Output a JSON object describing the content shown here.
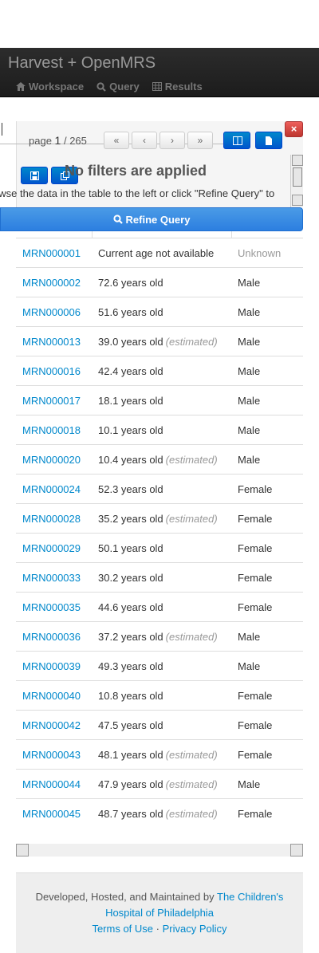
{
  "app": {
    "title": "Harvest + OpenMRS"
  },
  "nav": [
    {
      "label": "Workspace",
      "icon": "home-icon"
    },
    {
      "label": "Query",
      "icon": "search-icon"
    },
    {
      "label": "Results",
      "icon": "table-icon"
    }
  ],
  "pagination": {
    "prefix": "page",
    "current": "1",
    "total": "/ 265",
    "first_label": "«",
    "prev_label": "‹",
    "next_label": "›",
    "last_label": "»"
  },
  "panel": {
    "close_label": "×",
    "title": "No filters are applied",
    "text": "owse the data in the table to the left or click \"Refine Query\" to",
    "refine_label": "Refine Query"
  },
  "rows": [
    {
      "mrn": "MRN000001",
      "age": "Current age not available",
      "estimated": "",
      "sex": "Unknown"
    },
    {
      "mrn": "MRN000002",
      "age": "72.6 years old",
      "estimated": "",
      "sex": "Male"
    },
    {
      "mrn": "MRN000006",
      "age": "51.6 years old",
      "estimated": "",
      "sex": "Male"
    },
    {
      "mrn": "MRN000013",
      "age": "39.0 years old",
      "estimated": "(estimated)",
      "sex": "Male"
    },
    {
      "mrn": "MRN000016",
      "age": "42.4 years old",
      "estimated": "",
      "sex": "Male"
    },
    {
      "mrn": "MRN000017",
      "age": "18.1 years old",
      "estimated": "",
      "sex": "Male"
    },
    {
      "mrn": "MRN000018",
      "age": "10.1 years old",
      "estimated": "",
      "sex": "Male"
    },
    {
      "mrn": "MRN000020",
      "age": "10.4 years old",
      "estimated": "(estimated)",
      "sex": "Male"
    },
    {
      "mrn": "MRN000024",
      "age": "52.3 years old",
      "estimated": "",
      "sex": "Female"
    },
    {
      "mrn": "MRN000028",
      "age": "35.2 years old",
      "estimated": "(estimated)",
      "sex": "Female"
    },
    {
      "mrn": "MRN000029",
      "age": "50.1 years old",
      "estimated": "",
      "sex": "Female"
    },
    {
      "mrn": "MRN000033",
      "age": "30.2 years old",
      "estimated": "",
      "sex": "Female"
    },
    {
      "mrn": "MRN000035",
      "age": "44.6 years old",
      "estimated": "",
      "sex": "Female"
    },
    {
      "mrn": "MRN000036",
      "age": "37.2 years old",
      "estimated": "(estimated)",
      "sex": "Male"
    },
    {
      "mrn": "MRN000039",
      "age": "49.3 years old",
      "estimated": "",
      "sex": "Male"
    },
    {
      "mrn": "MRN000040",
      "age": "10.8 years old",
      "estimated": "",
      "sex": "Female"
    },
    {
      "mrn": "MRN000042",
      "age": "47.5 years old",
      "estimated": "",
      "sex": "Female"
    },
    {
      "mrn": "MRN000043",
      "age": "48.1 years old",
      "estimated": "(estimated)",
      "sex": "Female"
    },
    {
      "mrn": "MRN000044",
      "age": "47.9 years old",
      "estimated": "(estimated)",
      "sex": "Male"
    },
    {
      "mrn": "MRN000045",
      "age": "48.7 years old",
      "estimated": "(estimated)",
      "sex": "Female"
    }
  ],
  "footer": {
    "prefix": "Developed, Hosted, and Maintained by",
    "org_link": "The Children's Hospital of Philadelphia",
    "terms": "Terms of Use",
    "separator": "·",
    "privacy": "Privacy Policy"
  },
  "colors": {
    "link": "#0088cc",
    "primary": "#2c7fe0",
    "danger": "#bd362f",
    "navbar": "#1c1c1c"
  }
}
